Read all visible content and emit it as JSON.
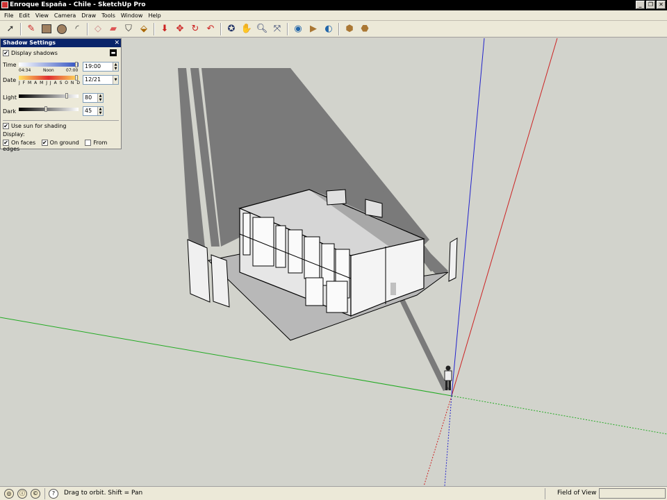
{
  "window": {
    "title": "Enroque España - Chile - SketchUp Pro"
  },
  "menu": [
    "File",
    "Edit",
    "View",
    "Camera",
    "Draw",
    "Tools",
    "Window",
    "Help"
  ],
  "toolbar": {
    "icons": [
      "select-icon",
      "pencil-icon",
      "rectangle-icon",
      "circle-icon",
      "arc-icon",
      "eraser-icon",
      "paint-bucket-icon",
      "tape-measure-icon",
      "push-pull-icon",
      "move-icon",
      "rotate-icon",
      "follow-me-icon",
      "orbit-icon",
      "pan-icon",
      "zoom-icon",
      "zoom-extents-icon",
      "warehouse-icon",
      "components-icon",
      "get-models-icon",
      "share-model-icon",
      "google-earth-icon"
    ]
  },
  "shadow_panel": {
    "title": "Shadow Settings",
    "display_shadows_label": "Display shadows",
    "display_shadows_checked": true,
    "time_label": "Time",
    "time_start": "04:34",
    "time_noon": "Noon",
    "time_end": "07:00",
    "time_value": "19:00",
    "date_label": "Date",
    "months": "J F M A M J J A S O N D",
    "date_value": "12/21",
    "light_label": "Light",
    "light_value": "80",
    "light_level": 0.8,
    "dark_label": "Dark",
    "dark_value": "45",
    "dark_level": 0.45,
    "use_sun_label": "Use sun for shading",
    "use_sun_checked": true,
    "display_label": "Display:",
    "on_faces_label": "On faces",
    "on_faces_checked": true,
    "on_ground_label": "On ground",
    "on_ground_checked": true,
    "from_edges_label": "From edges",
    "from_edges_checked": false
  },
  "status": {
    "hint": "Drag to orbit.  Shift = Pan",
    "measurement_label": "Field of View",
    "measurement_value": ""
  },
  "colors": {
    "red_axis": "#cc2222",
    "green_axis": "#22aa22",
    "blue_axis": "#2222cc",
    "ground": "#d2d3cc",
    "shadow": "#7a7a7a"
  }
}
